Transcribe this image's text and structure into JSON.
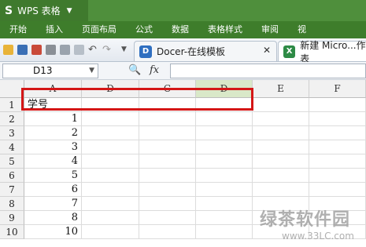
{
  "app": {
    "logo": "S",
    "title": "WPS 表格"
  },
  "ribbon_tabs": [
    "开始",
    "插入",
    "页面布局",
    "公式",
    "数据",
    "表格样式",
    "审阅",
    "视"
  ],
  "doc_tabs": [
    {
      "label": "Docer-在线模板"
    },
    {
      "label": "新建 Micro...作表"
    }
  ],
  "formula_bar": {
    "name_box": "D13",
    "fx_label": "fx",
    "value": ""
  },
  "sheet": {
    "columns": [
      "A",
      "D",
      "C",
      "D",
      "E",
      "F"
    ],
    "rows": [
      {
        "num": "1",
        "a": "学号"
      },
      {
        "num": "2",
        "a": "1"
      },
      {
        "num": "3",
        "a": "2"
      },
      {
        "num": "4",
        "a": "3"
      },
      {
        "num": "5",
        "a": "4"
      },
      {
        "num": "6",
        "a": "5"
      },
      {
        "num": "7",
        "a": "6"
      },
      {
        "num": "8",
        "a": "7"
      },
      {
        "num": "9",
        "a": "8"
      },
      {
        "num": "10",
        "a": "10"
      }
    ]
  },
  "watermark": {
    "name": "绿茶软件园",
    "url": "www.33LC.com"
  },
  "colors": {
    "titlebar": "#4f8f3c",
    "highlight": "#d41616"
  }
}
